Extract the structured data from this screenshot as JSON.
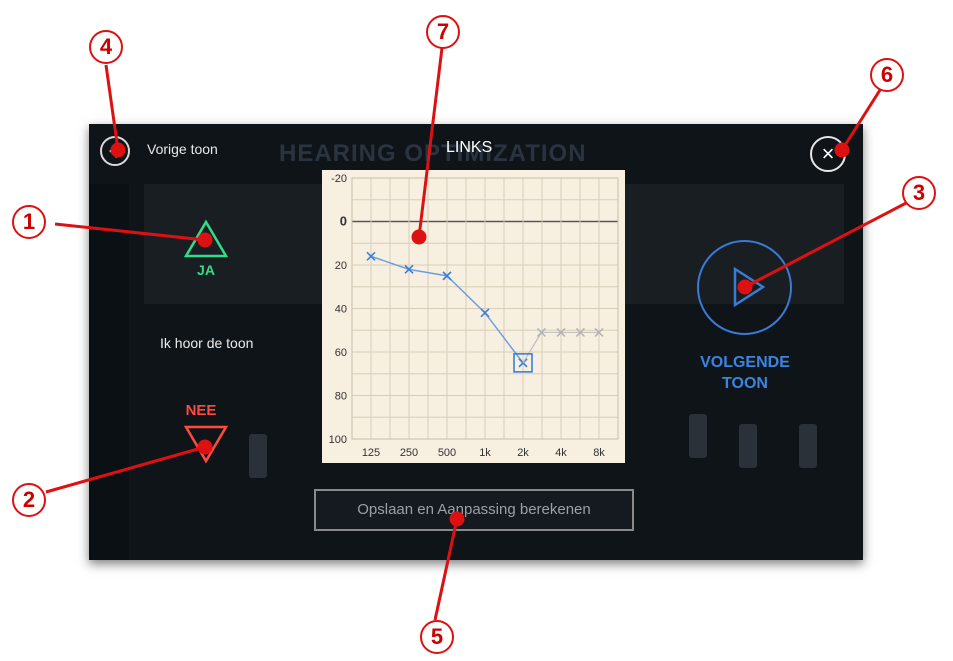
{
  "header": {
    "back_label": "Vorige toon",
    "side_title": "LINKS",
    "background_title": "HEARING OPTIMIZATION"
  },
  "answers": {
    "yes_label": "JA",
    "no_label": "NEE",
    "hear_label": "Ik hoor de toon",
    "yes_color": "#33dd88",
    "no_color": "#ff4a3d"
  },
  "next": {
    "label_line1": "VOLGENDE",
    "label_line2": "TOON",
    "color": "#3b84e0"
  },
  "save": {
    "label": "Opslaan en Aanpassing berekenen"
  },
  "markers": [
    "1",
    "2",
    "3",
    "4",
    "5",
    "6",
    "7"
  ],
  "chart_data": {
    "type": "line",
    "y_ticks": [
      "-20",
      "0",
      "20",
      "40",
      "60",
      "80",
      "100"
    ],
    "x_ticks": [
      "125",
      "250",
      "500",
      "1k",
      "2k",
      "4k",
      "8k"
    ],
    "ylim": [
      -20,
      100
    ],
    "y_inverted": true,
    "grid": true,
    "measured": {
      "x": [
        "125",
        "250",
        "500",
        "1k",
        "2k"
      ],
      "y": [
        16,
        22,
        25,
        42,
        65
      ]
    },
    "pending": {
      "x": [
        "2.8k",
        "4k",
        "5.7k",
        "8k"
      ],
      "y": [
        51,
        51,
        51,
        51
      ]
    },
    "current_point": {
      "x": "2k",
      "y": 65
    }
  }
}
